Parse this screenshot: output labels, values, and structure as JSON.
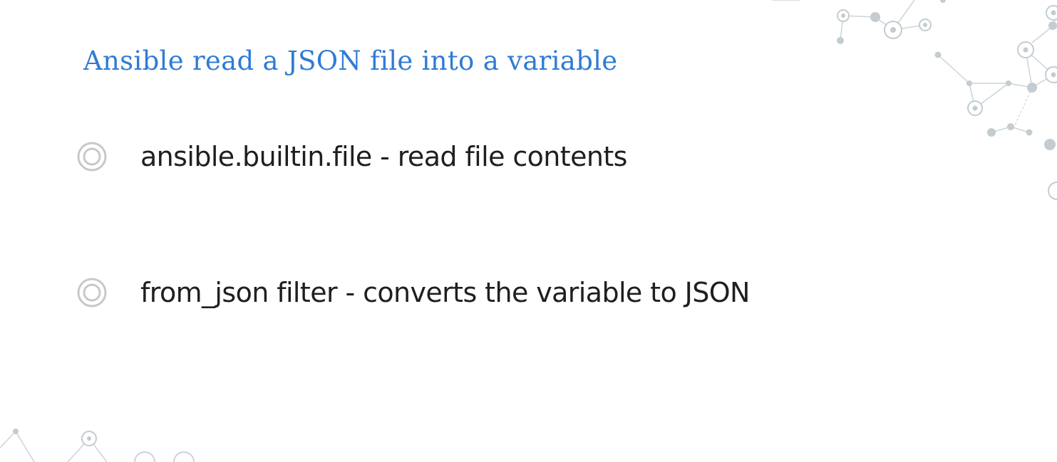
{
  "slide": {
    "title": "Ansible read a JSON file into a variable",
    "bullets": [
      {
        "text": "ansible.builtin.file - read file contents",
        "icon": "concentric-circle-bullet-icon"
      },
      {
        "text": "from_json filter - converts the variable to JSON",
        "icon": "concentric-circle-bullet-icon"
      }
    ]
  },
  "colors": {
    "title": "#2f7bd6",
    "body_text": "#1f1f1f",
    "bullet": "#c8c8c8",
    "decoration": "#b9c4c9"
  }
}
